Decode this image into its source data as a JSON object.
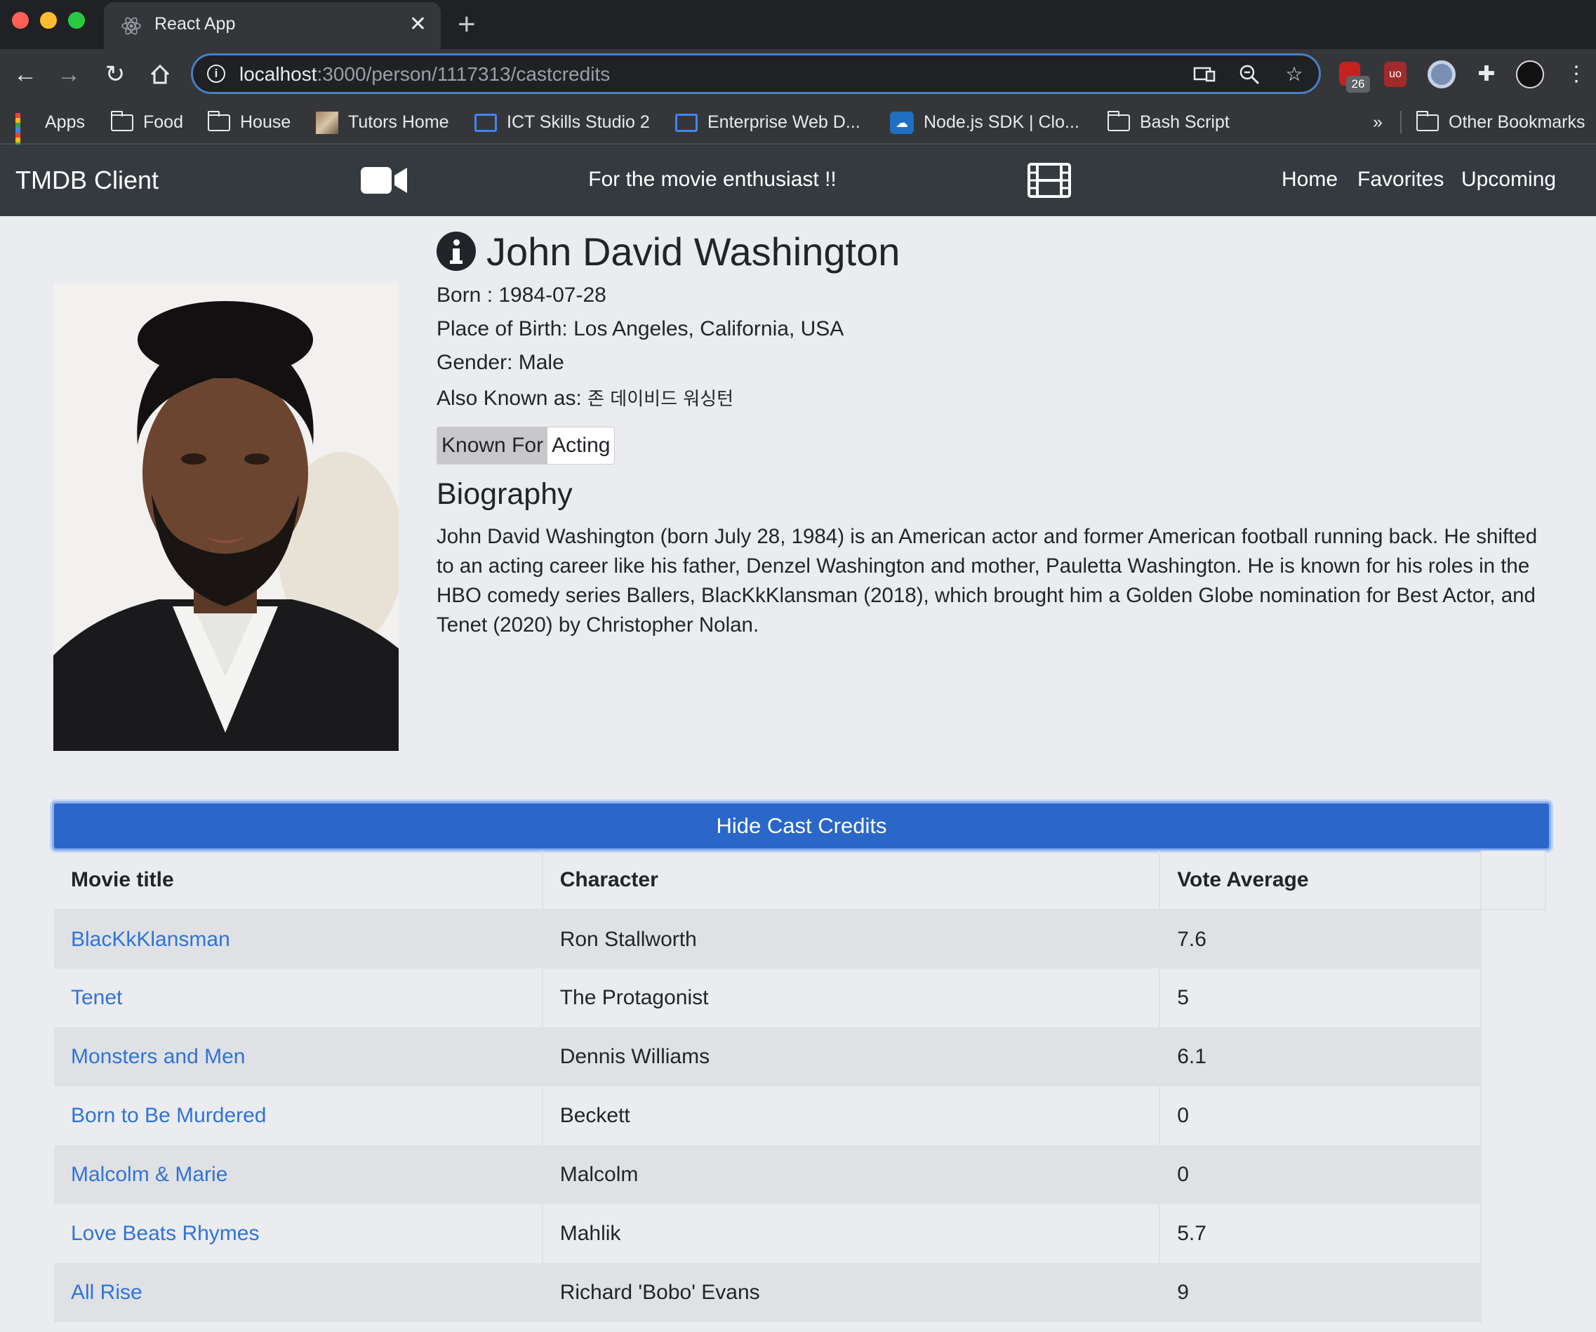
{
  "browser": {
    "tab_title": "React App",
    "url_host": "localhost",
    "url_rest": ":3000/person/1117313/castcredits",
    "extension_badge": "26",
    "bookmarks": [
      {
        "label": "Apps",
        "icon": "apps-grid-icon"
      },
      {
        "label": "Food",
        "icon": "folder-icon"
      },
      {
        "label": "House",
        "icon": "folder-icon"
      },
      {
        "label": "Tutors Home",
        "icon": "image-favicon-icon"
      },
      {
        "label": "ICT Skills Studio 2",
        "icon": "web-favicon-icon"
      },
      {
        "label": "Enterprise Web D...",
        "icon": "web-favicon-icon"
      },
      {
        "label": "Node.js SDK | Clo...",
        "icon": "cloud-favicon-icon"
      },
      {
        "label": "Bash Script",
        "icon": "folder-icon"
      }
    ],
    "more_bookmarks": "»",
    "other_bookmarks": "Other Bookmarks"
  },
  "navbar": {
    "brand": "TMDB Client",
    "tagline": "For the movie enthusiast !!",
    "links": [
      "Home",
      "Favorites",
      "Upcoming"
    ]
  },
  "person": {
    "name": "John David Washington",
    "born": "Born : 1984-07-28",
    "place_of_birth": "Place of Birth: Los Angeles, California, USA",
    "gender": "Gender: Male",
    "also_known_label": "Also Known as:",
    "also_known_value": "존 데이비드 워싱턴",
    "known_for_label": "Known For",
    "known_for_value": "Acting",
    "biography_title": "Biography",
    "biography": "John David Washington (born July 28, 1984) is an American actor and former American football running back. He shifted to an acting career like his father, Denzel Washington and mother, Pauletta Washington. He is known for his roles in the HBO comedy series Ballers, BlacKkKlansman (2018), which brought him a Golden Globe nomination for Best Actor, and Tenet (2020) by Christopher Nolan."
  },
  "credits": {
    "toggle_label": "Hide Cast Credits",
    "headers": [
      "Movie title",
      "Character",
      "Vote Average"
    ],
    "rows": [
      {
        "title": "BlacKkKlansman",
        "character": "Ron Stallworth",
        "vote": "7.6"
      },
      {
        "title": "Tenet",
        "character": "The Protagonist",
        "vote": "5"
      },
      {
        "title": "Monsters and Men",
        "character": "Dennis Williams",
        "vote": "6.1"
      },
      {
        "title": "Born to Be Murdered",
        "character": "Beckett",
        "vote": "0"
      },
      {
        "title": "Malcolm & Marie",
        "character": "Malcolm",
        "vote": "0"
      },
      {
        "title": "Love Beats Rhymes",
        "character": "Mahlik",
        "vote": "5.7"
      },
      {
        "title": "All Rise",
        "character": "Richard 'Bobo' Evans",
        "vote": "9"
      }
    ]
  },
  "colors": {
    "navbar_bg": "#343a40",
    "button_primary": "#2b66c9",
    "link": "#2f74d8",
    "page_bg": "#ebecef"
  }
}
